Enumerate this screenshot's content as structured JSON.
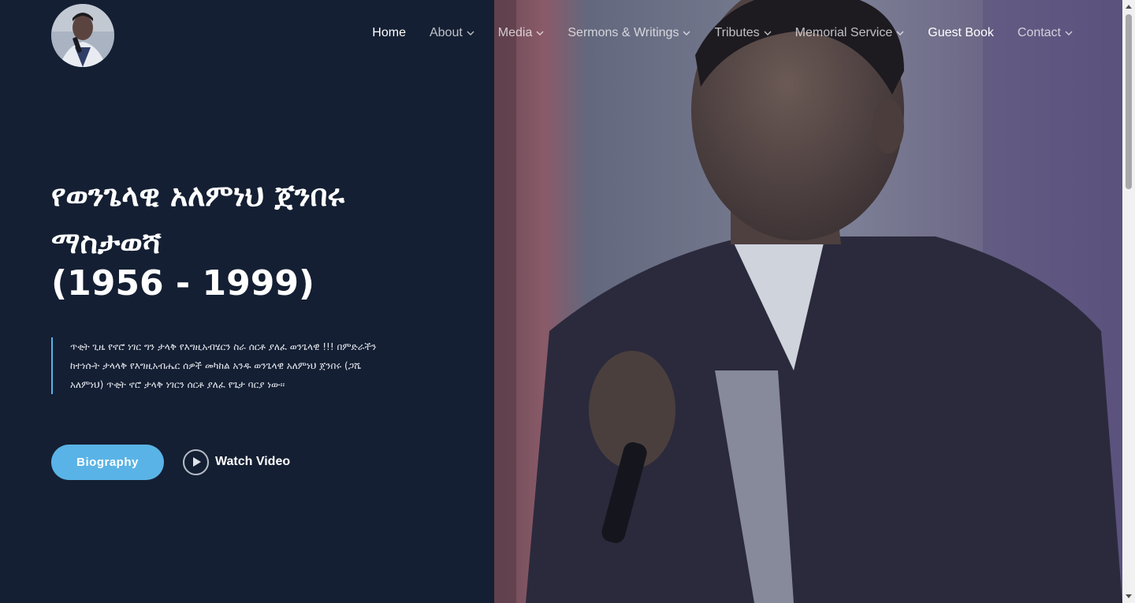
{
  "nav": {
    "items": [
      {
        "label": "Home",
        "has_dropdown": false,
        "state": "active"
      },
      {
        "label": "About",
        "has_dropdown": true,
        "state": "normal"
      },
      {
        "label": "Media",
        "has_dropdown": true,
        "state": "normal"
      },
      {
        "label": "Sermons & Writings",
        "has_dropdown": true,
        "state": "normal"
      },
      {
        "label": "Tributes",
        "has_dropdown": true,
        "state": "normal"
      },
      {
        "label": "Memorial Service",
        "has_dropdown": true,
        "state": "normal"
      },
      {
        "label": "Guest Book",
        "has_dropdown": false,
        "state": "bright"
      },
      {
        "label": "Contact",
        "has_dropdown": true,
        "state": "normal"
      }
    ]
  },
  "hero": {
    "title": "የወንጌላዊ አለምነህ ጀንበሩ ማስታወሻ",
    "years": "(1956 - 1999)",
    "quote": "ጥቂት ጊዜ የኖሮ ነገር ግን ታላቅ የእግዚአብሄርን ስራ ሰርቶ ያለፈ ወንጌላዊ !!! በምድራችን ከተነሱት ታላላቅ የእግዚአብሔር ሰዎች መካከል አንዱ ወንጌላዊ አለምነህ ጀንበሩ (ጋሼ አለምነህ) ጥቂት ኖሮ ታላቅ ነገርን ሰርቶ ያለፈ የጌታ ባርያ ነው፡፡",
    "biography_button": "Biography",
    "video_button": "Watch Video"
  },
  "colors": {
    "background": "#141f33",
    "accent": "#5ab3e6",
    "text": "#ffffff"
  },
  "icons": {
    "dropdown": "chevron-down-icon",
    "play": "play-icon"
  }
}
